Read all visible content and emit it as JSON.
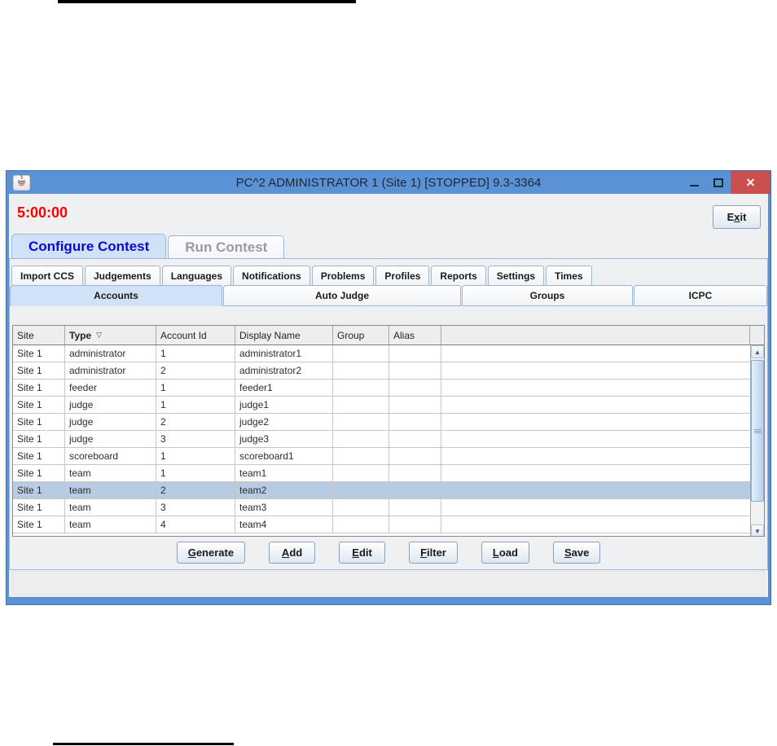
{
  "window": {
    "title": "PC^2 ADMINISTRATOR 1 (Site 1) [STOPPED] 9.3-3364"
  },
  "icons": {
    "close": "✕",
    "sort_descending": "▽",
    "scroll_up": "▲",
    "scroll_down": "▼"
  },
  "toolbar": {
    "timer": "5:00:00",
    "exit": {
      "pre": "E",
      "mnemonic": "x",
      "post": "it"
    }
  },
  "main_tabs": [
    {
      "label": "Configure Contest",
      "selected": true
    },
    {
      "label": "Run Contest",
      "selected": false
    }
  ],
  "sub_tabs": [
    "Import CCS",
    "Judgements",
    "Languages",
    "Notifications",
    "Problems",
    "Profiles",
    "Reports",
    "Settings",
    "Times"
  ],
  "section_tabs": [
    {
      "label": "Accounts",
      "selected": true
    },
    {
      "label": "Auto Judge",
      "selected": false
    },
    {
      "label": "Groups",
      "selected": false
    },
    {
      "label": "ICPC",
      "selected": false
    }
  ],
  "table": {
    "columns": [
      "Site",
      "Type",
      "Account Id",
      "Display Name",
      "Group",
      "Alias"
    ],
    "sorted_column": "Type",
    "selected_row_index": 8,
    "rows": [
      [
        "Site 1",
        "administrator",
        "1",
        "administrator1",
        "",
        ""
      ],
      [
        "Site 1",
        "administrator",
        "2",
        "administrator2",
        "",
        ""
      ],
      [
        "Site 1",
        "feeder",
        "1",
        "feeder1",
        "",
        ""
      ],
      [
        "Site 1",
        "judge",
        "1",
        "judge1",
        "",
        ""
      ],
      [
        "Site 1",
        "judge",
        "2",
        "judge2",
        "",
        ""
      ],
      [
        "Site 1",
        "judge",
        "3",
        "judge3",
        "",
        ""
      ],
      [
        "Site 1",
        "scoreboard",
        "1",
        "scoreboard1",
        "",
        ""
      ],
      [
        "Site 1",
        "team",
        "1",
        "team1",
        "",
        ""
      ],
      [
        "Site 1",
        "team",
        "2",
        "team2",
        "",
        ""
      ],
      [
        "Site 1",
        "team",
        "3",
        "team3",
        "",
        ""
      ],
      [
        "Site 1",
        "team",
        "4",
        "team4",
        "",
        ""
      ]
    ]
  },
  "actions": [
    {
      "pre": "",
      "mnemonic": "G",
      "post": "enerate"
    },
    {
      "pre": "",
      "mnemonic": "A",
      "post": "dd"
    },
    {
      "pre": "",
      "mnemonic": "E",
      "post": "dit"
    },
    {
      "pre": "",
      "mnemonic": "F",
      "post": "ilter"
    },
    {
      "pre": "",
      "mnemonic": "L",
      "post": "oad"
    },
    {
      "pre": "",
      "mnemonic": "S",
      "post": "ave"
    }
  ],
  "colors": {
    "titlebar": "#5b91d5",
    "close_button": "#c9504e",
    "timer_text": "#ff0000",
    "selected_tab_bg": "#d2e2f6",
    "selected_row_bg": "#b7cbe3",
    "active_main_tab_text": "#0909cf",
    "inactive_main_tab_text": "#9b9b9b"
  }
}
